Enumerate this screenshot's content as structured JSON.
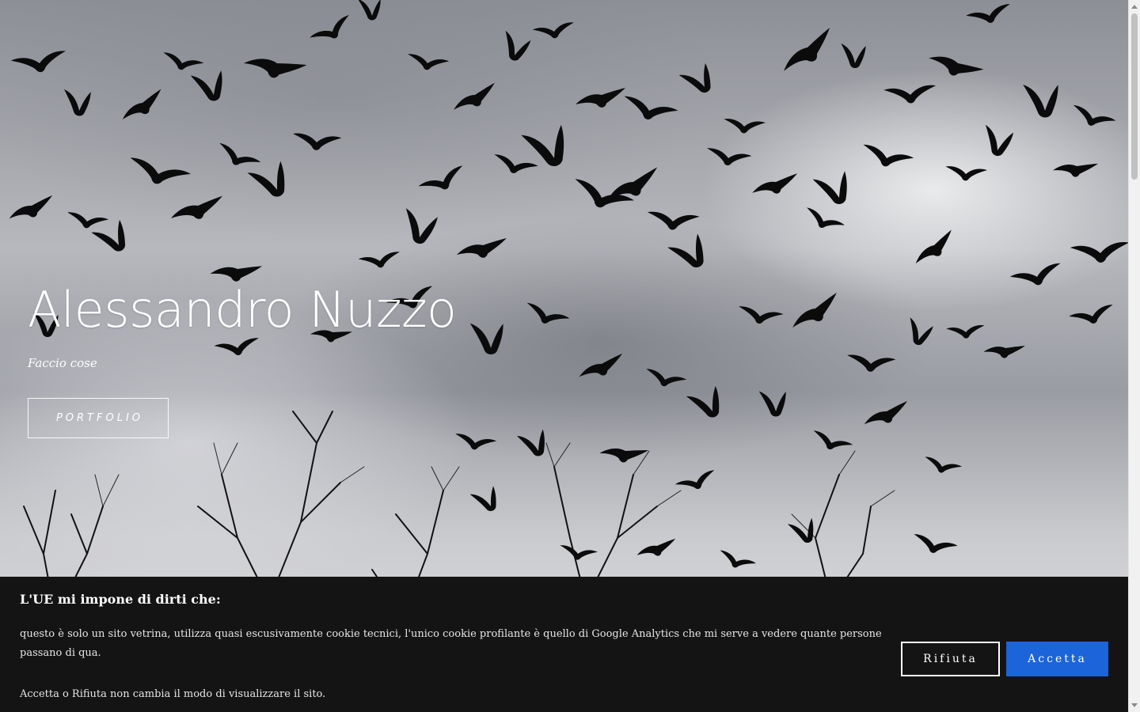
{
  "hero": {
    "title": "Alessandro Nuzzo",
    "tagline": "Faccio cose",
    "portfolio_button": "PORTFOLIO"
  },
  "cookie_banner": {
    "title": "L'UE mi impone di dirti che:",
    "text": "questo è solo un sito vetrina, utilizza quasi escusivamente cookie tecnici, l'unico cookie profilante è quello di Google Analytics che mi serve a vedere quante persone passano di qua.",
    "text_2": "Accetta o Rifiuta non cambia il modo di visualizzare il sito.",
    "reject_button": "Rifiuta",
    "accept_button": "Accetta",
    "accept_color": "#1b64d9"
  },
  "scrollbar": {
    "position": 0.0
  }
}
